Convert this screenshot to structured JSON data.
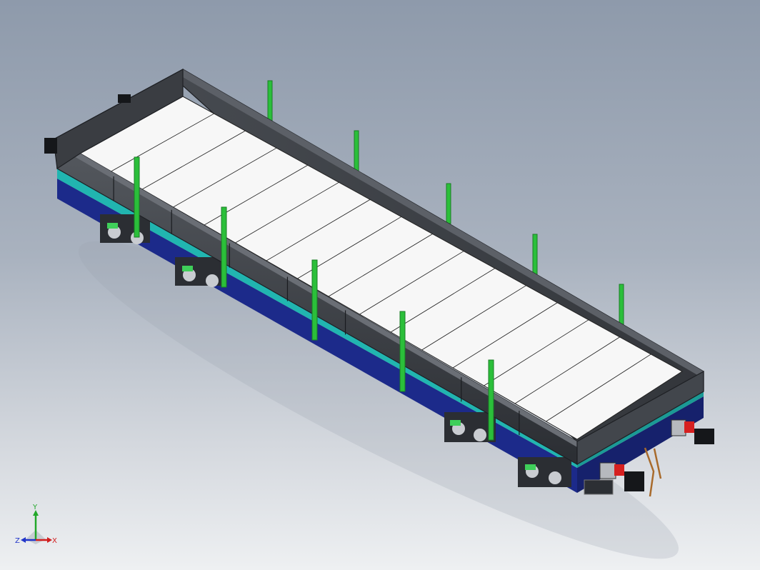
{
  "viewport": {
    "background_top": "#8e9aab",
    "background_bottom": "#eef0f2"
  },
  "model": {
    "body_color": "#3c3f44",
    "deck_color": "#f7f7f7",
    "stripe_color": "#21b5b0",
    "underframe_color": "#1c2a8a",
    "stake_color": "#2bbf3a",
    "coupler_color": "#d62020",
    "deck_plank_count": 16
  },
  "triad": {
    "x_label": "X",
    "y_label": "Y",
    "z_label": "Z",
    "x_color": "#d11f1f",
    "y_color": "#22a82a",
    "z_color": "#2236c9"
  }
}
